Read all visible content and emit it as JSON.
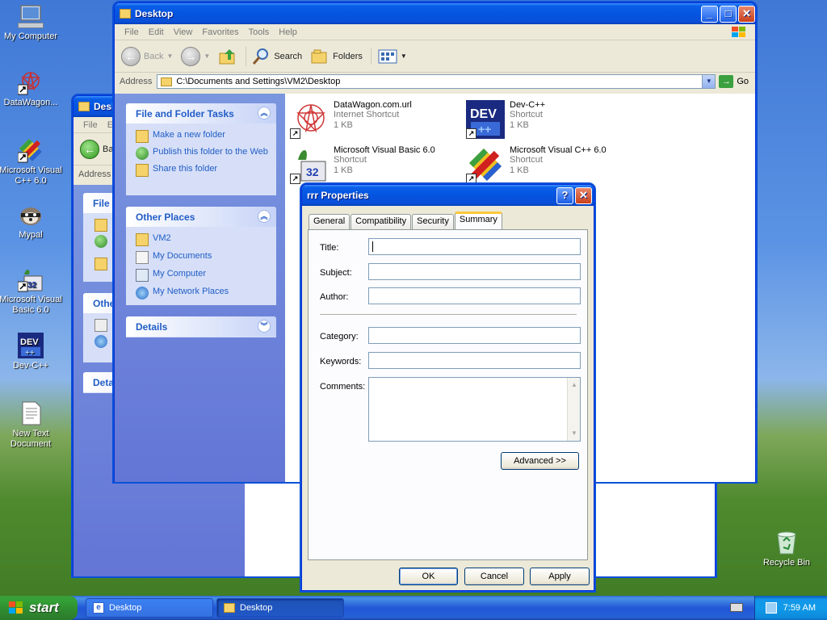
{
  "desktop": {
    "icons": [
      {
        "label": "My Computer",
        "icon": "my-computer-icon"
      },
      {
        "label": "DataWagon...",
        "icon": "datawagon-icon"
      },
      {
        "label": "Microsoft Visual C++ 6.0",
        "icon": "visual-cpp-icon"
      },
      {
        "label": "Mypal",
        "icon": "mypal-icon"
      },
      {
        "label": "Microsoft Visual Basic 6.0",
        "icon": "visual-basic-icon"
      },
      {
        "label": "Dev-C++",
        "icon": "dev-cpp-icon"
      },
      {
        "label": "New Text Document",
        "icon": "text-document-icon"
      },
      {
        "label": "Recycle Bin",
        "icon": "recycle-bin-icon"
      }
    ]
  },
  "back_window": {
    "title": "Desk",
    "menu": [
      "File",
      "E"
    ],
    "back": "Ba",
    "address": "Address",
    "panes": [
      "File",
      "Othe",
      "Deta"
    ]
  },
  "explorer": {
    "title": "Desktop",
    "menu": [
      "File",
      "Edit",
      "View",
      "Favorites",
      "Tools",
      "Help"
    ],
    "toolbar": {
      "back": "Back",
      "search": "Search",
      "folders": "Folders"
    },
    "address_label": "Address",
    "address_value": "C:\\Documents and Settings\\VM2\\Desktop",
    "go": "Go",
    "tasks": {
      "title": "File and Folder Tasks",
      "items": [
        "Make a new folder",
        "Publish this folder to the Web",
        "Share this folder"
      ]
    },
    "places": {
      "title": "Other Places",
      "items": [
        "VM2",
        "My Documents",
        "My Computer",
        "My Network Places"
      ]
    },
    "details": {
      "title": "Details"
    },
    "files": [
      {
        "name": "DataWagon.com.url",
        "type": "Internet Shortcut",
        "size": "1 KB",
        "icon": "datawagon-icon"
      },
      {
        "name": "Dev-C++",
        "type": "Shortcut",
        "size": "1 KB",
        "icon": "dev-cpp-icon"
      },
      {
        "name": "Microsoft Visual Basic 6.0",
        "type": "Shortcut",
        "size": "1 KB",
        "icon": "visual-basic-icon"
      },
      {
        "name": "Microsoft Visual C++ 6.0",
        "type": "Shortcut",
        "size": "1 KB",
        "icon": "visual-cpp-icon"
      }
    ]
  },
  "dialog": {
    "title": "rrr Properties",
    "tabs": [
      "General",
      "Compatibility",
      "Security",
      "Summary"
    ],
    "active_tab": "Summary",
    "fields": {
      "title": "Title:",
      "subject": "Subject:",
      "author": "Author:",
      "category": "Category:",
      "keywords": "Keywords:",
      "comments": "Comments:"
    },
    "advanced": "Advanced >>",
    "ok": "OK",
    "cancel": "Cancel",
    "apply": "Apply"
  },
  "taskbar": {
    "start": "start",
    "tasks": [
      "Desktop",
      "Desktop"
    ],
    "clock": "7:59 AM"
  },
  "colors": {
    "xp_blue": "#0a5fe8",
    "pane_link": "#215dc6",
    "start_green": "#33a136"
  }
}
